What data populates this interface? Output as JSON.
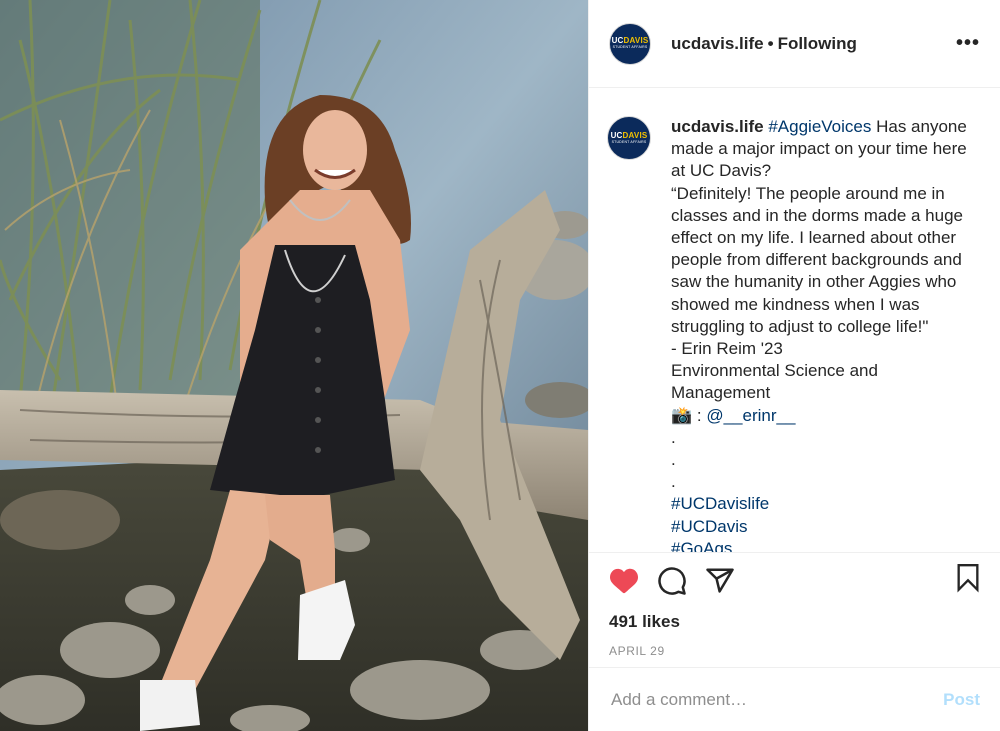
{
  "header": {
    "username": "ucdavis.life",
    "separator": "•",
    "follow_status": "Following",
    "more_label": "•••"
  },
  "avatar": {
    "uc": "UC",
    "davis": "DAVIS",
    "subtitle": "STUDENT AFFAIRS"
  },
  "caption": {
    "username": "ucdavis.life",
    "hashtag": "#AggieVoices",
    "line1_rest": " Has anyone",
    "line2": "made a major impact on your time here",
    "line3": "at UC Davis?",
    "line4": "“Definitely! The people around me in",
    "line5": "classes and in the dorms made a huge",
    "line6": "effect on my life. I learned about other",
    "line7": "people from different backgrounds and",
    "line8": "saw the humanity in other Aggies who",
    "line9": "showed me kindness when I was",
    "line10": "struggling to adjust to college life!\"",
    "line11": "- Erin Reim '23",
    "line12": "Environmental Science and",
    "line13": "Management",
    "camera_emoji": "📸",
    "credit_prefix": " : ",
    "credit_handle": "@__erinr__",
    "dot1": ".",
    "dot2": ".",
    "dot3": ".",
    "tag1": "#UCDavislife",
    "tag2": "#UCDavis",
    "tag3": "#GoAgs"
  },
  "actions": {
    "like_icon": "heart-filled-icon",
    "comment_icon": "comment-icon",
    "share_icon": "paper-plane-icon",
    "save_icon": "bookmark-icon",
    "like_color": "#ed4956"
  },
  "likes": "491 likes",
  "date": "APRIL 29",
  "comment_box": {
    "placeholder": "Add a comment…",
    "post_label": "Post",
    "post_color": "#b2dffc"
  }
}
